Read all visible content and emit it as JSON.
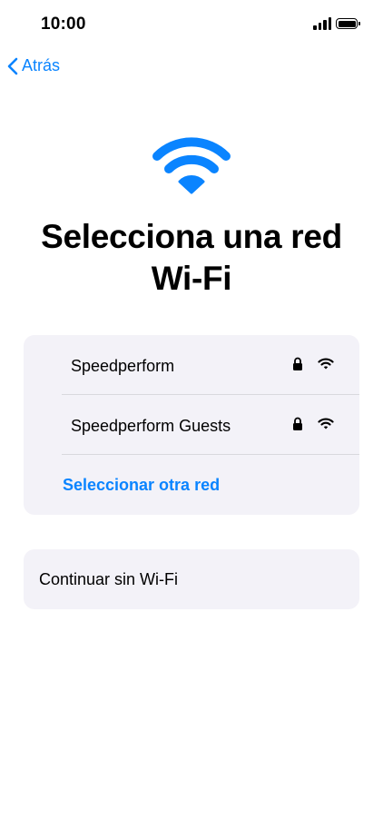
{
  "status_bar": {
    "time": "10:00"
  },
  "nav": {
    "back_label": "Atrás",
    "back_icon": "chevron-left-icon"
  },
  "header": {
    "icon": "wifi-icon",
    "title_line1": "Selecciona una red",
    "title_line2": "Wi-Fi"
  },
  "networks": [
    {
      "name": "Speedperform",
      "secured": true,
      "icon": "wifi-icon"
    },
    {
      "name": "Speedperform Guests",
      "secured": true,
      "icon": "wifi-icon"
    }
  ],
  "other_network_label": "Seleccionar otra red",
  "continue_without_wifi_label": "Continuar sin Wi-Fi",
  "colors": {
    "accent": "#0a84ff",
    "card_background": "#f3f2f8",
    "separator": "#d9d9de"
  }
}
